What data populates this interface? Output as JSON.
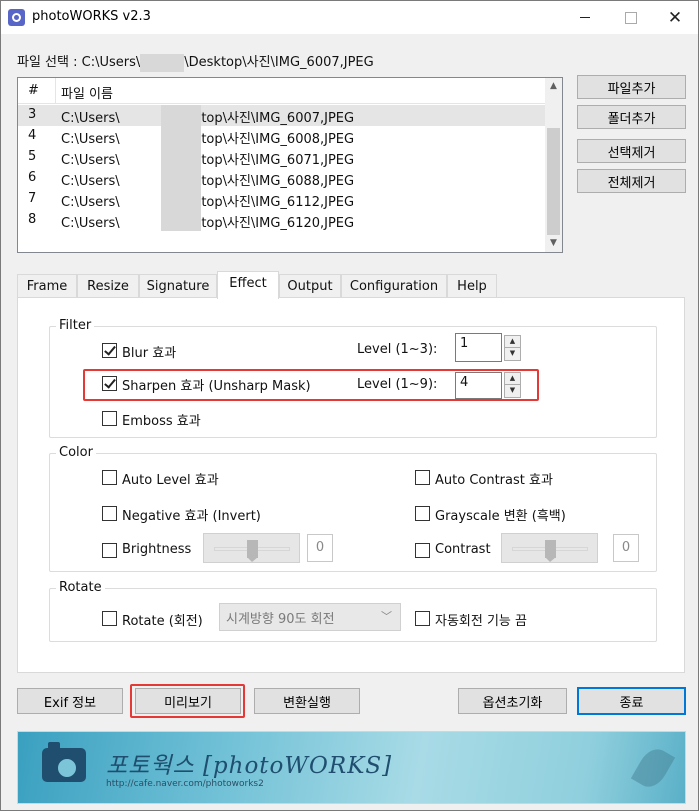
{
  "window": {
    "title": "photoWORKS v2.3",
    "close_glyph": "✕"
  },
  "file_select": {
    "label": "파일 선택 : C:\\Users\\",
    "path_tail": "\\Desktop\\사진\\IMG_6007,JPEG"
  },
  "file_list": {
    "col_num": "#",
    "col_name": "파일 이름",
    "rows": [
      {
        "num": "3",
        "path_head": "C:\\Users\\",
        "path_tail": "\\Desktop\\사진\\IMG_6007,JPEG"
      },
      {
        "num": "4",
        "path_head": "C:\\Users\\",
        "path_tail": "\\Desktop\\사진\\IMG_6008,JPEG"
      },
      {
        "num": "5",
        "path_head": "C:\\Users\\",
        "path_tail": "\\Desktop\\사진\\IMG_6071,JPEG"
      },
      {
        "num": "6",
        "path_head": "C:\\Users\\",
        "path_tail": "\\Desktop\\사진\\IMG_6088,JPEG"
      },
      {
        "num": "7",
        "path_head": "C:\\Users\\",
        "path_tail": "\\Desktop\\사진\\IMG_6112,JPEG"
      },
      {
        "num": "8",
        "path_head": "C:\\Users\\",
        "path_tail": "\\Desktop\\사진\\IMG_6120,JPEG"
      }
    ],
    "scroll_up": "▲",
    "scroll_down": "▼"
  },
  "side_buttons": {
    "add_file": "파일추가",
    "add_folder": "폴더추가",
    "remove_selected": "선택제거",
    "remove_all": "전체제거"
  },
  "tabs": [
    "Frame",
    "Resize",
    "Signature",
    "Effect",
    "Output",
    "Configuration",
    "Help"
  ],
  "active_tab": "Effect",
  "filter": {
    "group": "Filter",
    "blur": {
      "label": "Blur 효과",
      "checked": true,
      "level_label": "Level (1~3):",
      "level": "1"
    },
    "sharpen": {
      "label": "Sharpen 효과 (Unsharp Mask)",
      "checked": true,
      "level_label": "Level (1~9):",
      "level": "4"
    },
    "emboss": {
      "label": "Emboss 효과",
      "checked": false
    }
  },
  "color": {
    "group": "Color",
    "auto_level": "Auto Level 효과",
    "auto_contrast": "Auto Contrast 효과",
    "negative": "Negative 효과 (Invert)",
    "grayscale": "Grayscale 변환 (흑백)",
    "brightness": {
      "label": "Brightness",
      "value": "0",
      "slider_position": 0.5
    },
    "contrast": {
      "label": "Contrast",
      "value": "0",
      "slider_position": 0.5
    }
  },
  "rotate": {
    "group": "Rotate",
    "label": "Rotate (회전)",
    "selected": "시계방향 90도 회전",
    "auto_rotate_off": "자동회전 기능 끔"
  },
  "bottom_buttons": {
    "exif": "Exif 정보",
    "preview": "미리보기",
    "convert": "변환실행",
    "reset_options": "옵션초기화",
    "exit": "종료"
  },
  "banner": {
    "brand": "포토웍스 [photoWORKS]",
    "url": "http://cafe.naver.com/photoworks2"
  },
  "colors": {
    "highlight": "#e53935",
    "accent": "#0078d7",
    "brand": "#1f4e6e"
  }
}
